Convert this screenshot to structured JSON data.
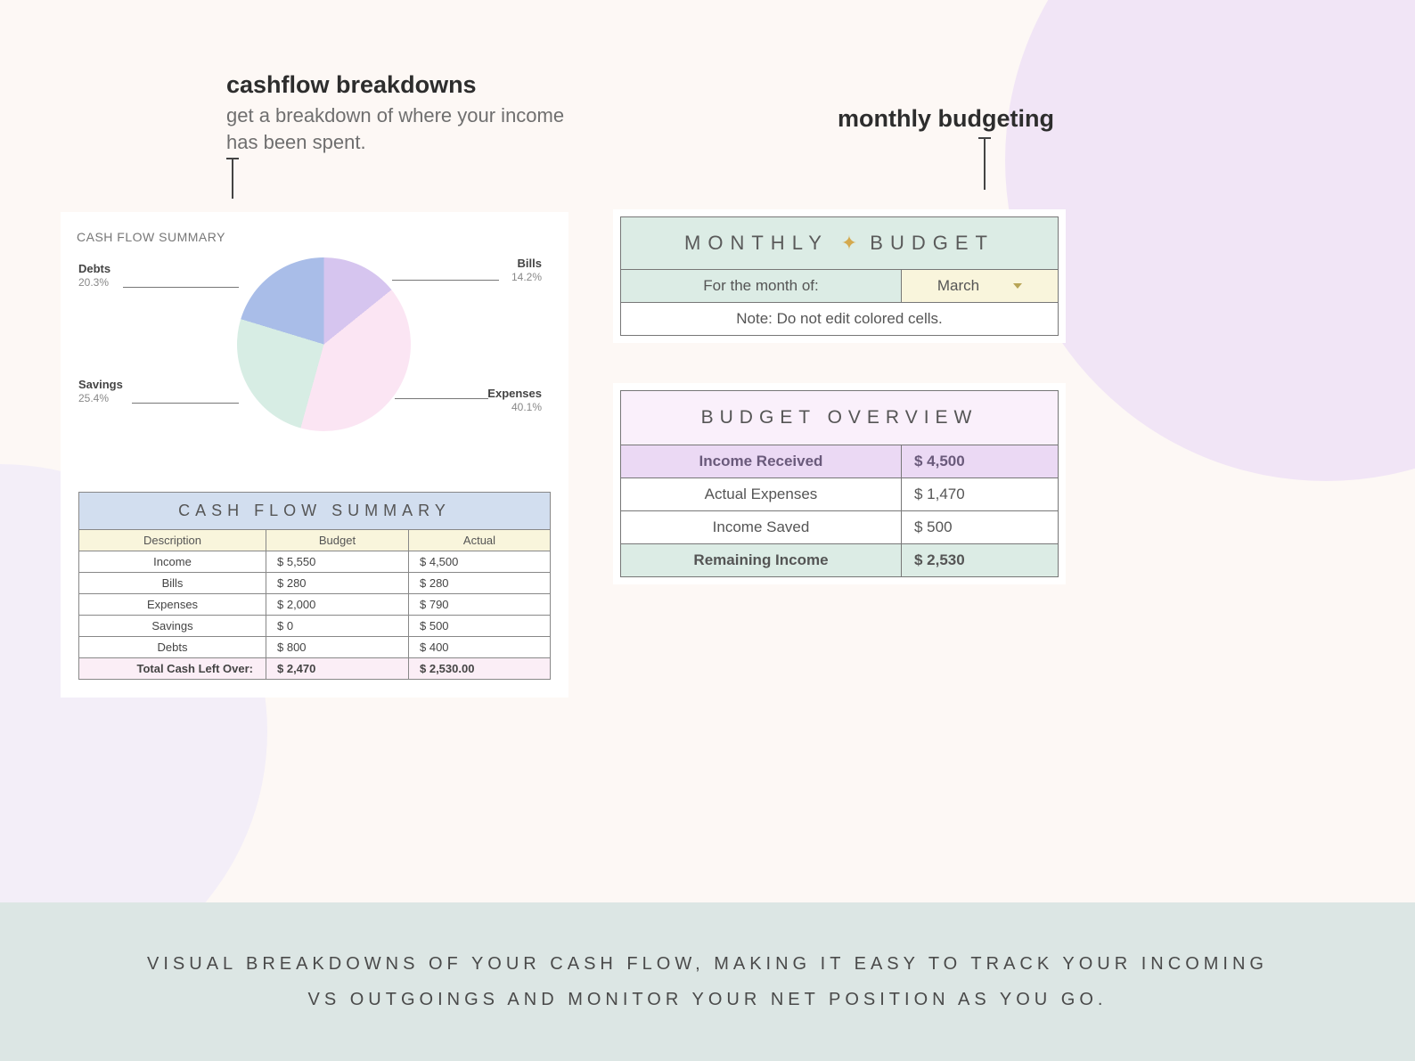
{
  "headings": {
    "cashflow": "cashflow breakdowns",
    "cashflow_sub": "get a breakdown of where your income has been spent.",
    "budgeting": "monthly budgeting"
  },
  "chart_data": {
    "type": "pie",
    "title": "CASH FLOW SUMMARY",
    "series": [
      {
        "name": "Bills",
        "value": 14.2,
        "label": "14.2%",
        "color": "#d6c5ef"
      },
      {
        "name": "Expenses",
        "value": 40.1,
        "label": "40.1%",
        "color": "#fbe5f3"
      },
      {
        "name": "Savings",
        "value": 25.4,
        "label": "25.4%",
        "color": "#d7ede4"
      },
      {
        "name": "Debts",
        "value": 20.3,
        "label": "20.3%",
        "color": "#a9bde8"
      }
    ]
  },
  "cashflow_table": {
    "title": "CASH FLOW SUMMARY",
    "cols": {
      "c1": "Description",
      "c2": "Budget",
      "c3": "Actual"
    },
    "rows": [
      {
        "desc": "Income",
        "budget": "$  5,550",
        "actual": "$  4,500"
      },
      {
        "desc": "Bills",
        "budget": "$  280",
        "actual": "$  280"
      },
      {
        "desc": "Expenses",
        "budget": "$  2,000",
        "actual": "$  790"
      },
      {
        "desc": "Savings",
        "budget": "$  0",
        "actual": "$  500"
      },
      {
        "desc": "Debts",
        "budget": "$  800",
        "actual": "$  400"
      }
    ],
    "total": {
      "desc": "Total Cash Left Over:",
      "budget": "$  2,470",
      "actual": "$  2,530.00"
    }
  },
  "monthly_budget": {
    "title_left": "MONTHLY",
    "title_right": "BUDGET",
    "for_label": "For the month of:",
    "month": "March",
    "note": "Note: Do not edit colored cells."
  },
  "budget_overview": {
    "title": "BUDGET OVERVIEW",
    "rows": [
      {
        "label": "Income Received",
        "value": "$   4,500",
        "accent": "lilac"
      },
      {
        "label": "Actual Expenses",
        "value": "$   1,470",
        "accent": ""
      },
      {
        "label": "Income Saved",
        "value": "$   500",
        "accent": ""
      },
      {
        "label": "Remaining Income",
        "value": "$   2,530",
        "accent": "mint"
      }
    ]
  },
  "footer": "VISUAL BREAKDOWNS OF YOUR CASH FLOW, MAKING IT EASY TO TRACK YOUR INCOMING VS OUTGOINGS AND MONITOR YOUR NET POSITION AS YOU GO."
}
